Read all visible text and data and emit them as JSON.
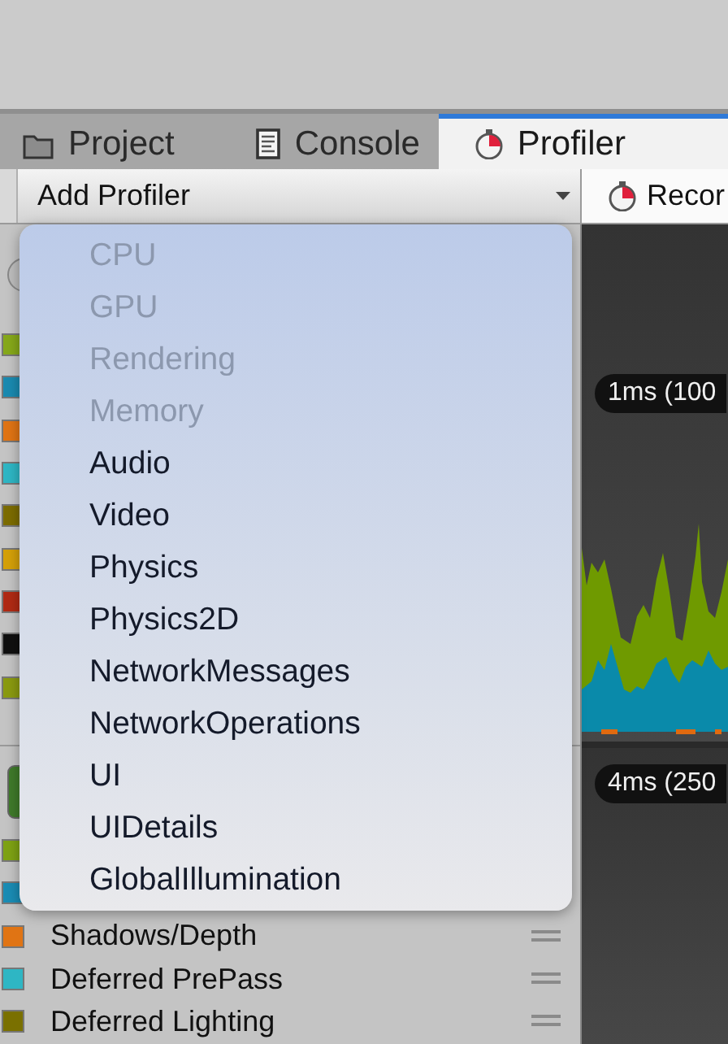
{
  "tabs": [
    {
      "label": "Project",
      "kind": "folder",
      "selected": false
    },
    {
      "label": "Console",
      "kind": "log",
      "selected": false
    },
    {
      "label": "Profiler",
      "kind": "stopwatch",
      "selected": true
    }
  ],
  "toolbar": {
    "add_profiler": {
      "label": "Add Profiler"
    },
    "record": {
      "label": "Recor"
    }
  },
  "sections": [
    {
      "kind": "circle",
      "rows": [
        {
          "color": "#86a81a"
        },
        {
          "color": "#1a8ab0"
        },
        {
          "color": "#e07414"
        },
        {
          "color": "#2eb6c4"
        },
        {
          "color": "#7c6c00"
        },
        {
          "color": "#d4a008"
        },
        {
          "color": "#b02a14"
        },
        {
          "color": "#101010"
        },
        {
          "color": "#8a9a10"
        }
      ]
    },
    {
      "kind": "square",
      "rows": [
        {
          "color": "#7ea214"
        },
        {
          "color": "#1a8cb4"
        },
        {
          "color": "#e07414",
          "label": "Shadows/Depth"
        },
        {
          "color": "#2eb6c4",
          "label": "Deferred PrePass"
        },
        {
          "color": "#7a7000",
          "label": "Deferred Lighting"
        }
      ]
    }
  ],
  "graphs": [
    {
      "scale_label": "1ms (100"
    },
    {
      "scale_label": "4ms (250"
    }
  ],
  "menu": {
    "items": [
      {
        "label": "CPU",
        "disabled": true
      },
      {
        "label": "GPU",
        "disabled": true
      },
      {
        "label": "Rendering",
        "disabled": true
      },
      {
        "label": "Memory",
        "disabled": true
      },
      {
        "label": "Audio",
        "disabled": false
      },
      {
        "label": "Video",
        "disabled": false
      },
      {
        "label": "Physics",
        "disabled": false
      },
      {
        "label": "Physics2D",
        "disabled": false
      },
      {
        "label": "NetworkMessages",
        "disabled": false
      },
      {
        "label": "NetworkOperations",
        "disabled": false
      },
      {
        "label": "UI",
        "disabled": false
      },
      {
        "label": "UIDetails",
        "disabled": false
      },
      {
        "label": "GlobalIllumination",
        "disabled": false
      }
    ]
  }
}
